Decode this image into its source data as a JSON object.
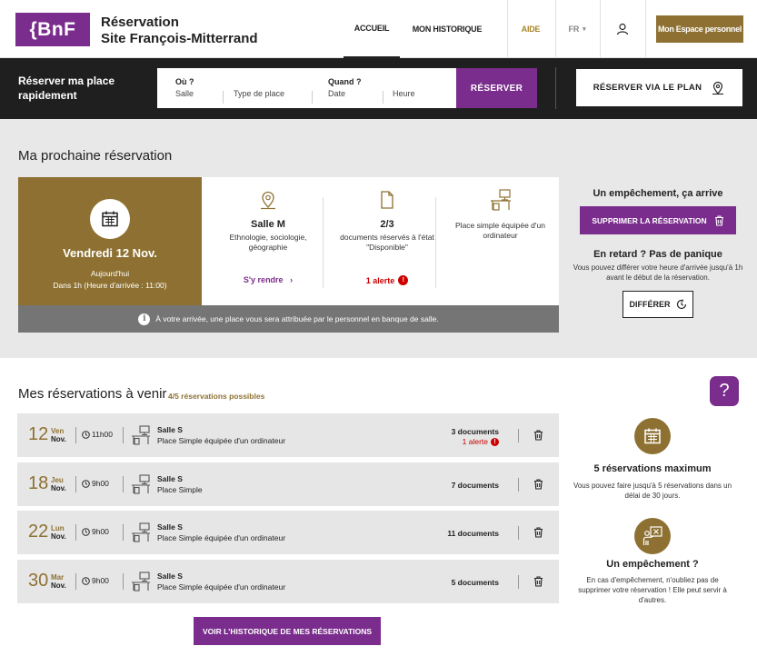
{
  "header": {
    "logo": "{BnF",
    "title_line1": "Réservation",
    "title_line2": "Site François-Mitterrand",
    "nav_accueil": "ACCUEIL",
    "nav_historique": "MON HISTORIQUE",
    "nav_aide": "AIDE",
    "nav_lang": "FR",
    "espace_label": "Mon Espace personnel"
  },
  "booking": {
    "quick_title": "Réserver ma place rapidement",
    "where_label": "Où ?",
    "where_room": "Salle",
    "where_type": "Type de place",
    "when_label": "Quand ?",
    "when_date": "Date",
    "when_time": "Heure",
    "reserve_label": "RÉSERVER",
    "plan_label": "RÉSERVER VIA LE PLAN"
  },
  "next": {
    "section_title": "Ma prochaine réservation",
    "date": "Vendredi 12 Nov.",
    "relative_line1": "Aujourd'hui",
    "relative_line2": "Dans 1h (Heure d'arrivée : 11:00)",
    "room": "Salle M",
    "room_desc": "Ethnologie, sociologie, géographie",
    "room_link": "S'y rendre",
    "docs": "2/3",
    "docs_desc": "documents réservés à l'état \"Disponible\"",
    "docs_alert": "1 alerte",
    "seat_desc": "Place simple équipée d'un ordinateur",
    "arrival_note": "À votre arrivée, une place vous sera attribuée par le personnel en banque de salle.",
    "side_h1": "Un empêchement, ça arrive",
    "delete_label": "SUPPRIMER LA RÉSERVATION",
    "side_h2": "En retard ? Pas de panique",
    "side_p": "Vous pouvez différer votre heure d'arrivée jusqu'à 1h avant le début de la réservation.",
    "defer_label": "DIFFÉRER"
  },
  "upcoming": {
    "title": "Mes réservations à venir",
    "count": "4/5 réservations possibles",
    "rows": [
      {
        "day": "12",
        "weekday": "Ven",
        "month": "Nov.",
        "time": "11h00",
        "room": "Salle S",
        "type": "Place Simple équipée d'un ordinateur",
        "docs": "3 documents",
        "alert": "1 alerte"
      },
      {
        "day": "18",
        "weekday": "Jeu",
        "month": "Nov.",
        "time": "9h00",
        "room": "Salle S",
        "type": "Place Simple",
        "docs": "7 documents"
      },
      {
        "day": "22",
        "weekday": "Lun",
        "month": "Nov.",
        "time": "9h00",
        "room": "Salle S",
        "type": "Place Simple équipée d'un ordinateur",
        "docs": "11 documents"
      },
      {
        "day": "30",
        "weekday": "Mar",
        "month": "Nov.",
        "time": "9h00",
        "room": "Salle S",
        "type": "Place Simple équipée d'un ordinateur",
        "docs": "5 documents"
      }
    ],
    "history_label": "VOIR L'HISTORIQUE DE MES RÉSERVATIONS",
    "side_max_title": "5 réservations maximum",
    "side_max_p": "Vous pouvez faire jusqu'à 5 réservations dans un délai de 30 jours.",
    "side_imp_title": "Un empêchement ?",
    "side_imp_p": "En cas d'empêchement, n'oubliez pas de supprimer votre réservation ! Elle peut servir à d'autres.",
    "help": "?"
  },
  "colors": {
    "accent": "#7a2d8c",
    "gold": "#8e7132",
    "alert": "#cc0000",
    "dark": "#1f1f1f"
  }
}
